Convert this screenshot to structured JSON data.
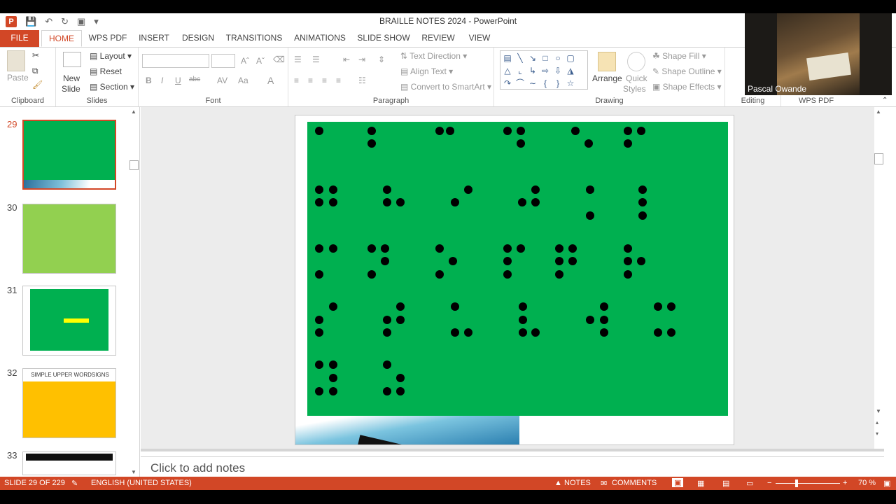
{
  "window": {
    "title": "BRAILLE NOTES 2024 - PowerPoint"
  },
  "tabs": [
    {
      "label": "FILE",
      "kind": "file"
    },
    {
      "label": "HOME",
      "kind": "active"
    },
    {
      "label": "WPS PDF",
      "kind": "normal"
    },
    {
      "label": "INSERT",
      "kind": "normal"
    },
    {
      "label": "DESIGN",
      "kind": "normal"
    },
    {
      "label": "TRANSITIONS",
      "kind": "normal"
    },
    {
      "label": "ANIMATIONS",
      "kind": "normal"
    },
    {
      "label": "SLIDE SHOW",
      "kind": "normal"
    },
    {
      "label": "REVIEW",
      "kind": "normal"
    },
    {
      "label": "VIEW",
      "kind": "normal"
    }
  ],
  "ribbon": {
    "clipboard": {
      "group": "Clipboard",
      "paste": "Paste"
    },
    "slides": {
      "group": "Slides",
      "new_slide_1": "New",
      "new_slide_2": "Slide",
      "layout": "Layout",
      "reset": "Reset",
      "section": "Section"
    },
    "font": {
      "group": "Font",
      "bold": "B",
      "italic": "I",
      "underline": "U",
      "strike": "abc",
      "spacing": "AV",
      "case": "Aa",
      "color": "A"
    },
    "paragraph": {
      "group": "Paragraph",
      "text_direction": "Text Direction",
      "align_text": "Align Text",
      "convert_smartart": "Convert to SmartArt"
    },
    "drawing": {
      "group": "Drawing",
      "arrange": "Arrange",
      "quick_styles_1": "Quick",
      "quick_styles_2": "Styles",
      "shape_fill": "Shape Fill",
      "shape_outline": "Shape Outline",
      "shape_effects": "Shape Effects"
    },
    "editing": {
      "group": "Editing"
    },
    "wps": {
      "group": "WPS PDF"
    }
  },
  "thumbnails": [
    {
      "num": "29",
      "selected": true
    },
    {
      "num": "30",
      "selected": false
    },
    {
      "num": "31",
      "selected": false
    },
    {
      "num": "32",
      "selected": false,
      "title": "SIMPLE UPPER WORDSIGNS"
    },
    {
      "num": "33",
      "selected": false
    }
  ],
  "notes": {
    "placeholder": "Click to add notes"
  },
  "status": {
    "slide": "SLIDE 29 OF 229",
    "language": "ENGLISH (UNITED STATES)",
    "notes": "NOTES",
    "comments": "COMMENTS",
    "zoom": "70 %"
  },
  "webcam": {
    "name": "Pascal Owande"
  },
  "colors": {
    "accent": "#d24726",
    "slide_green": "#00b050"
  }
}
